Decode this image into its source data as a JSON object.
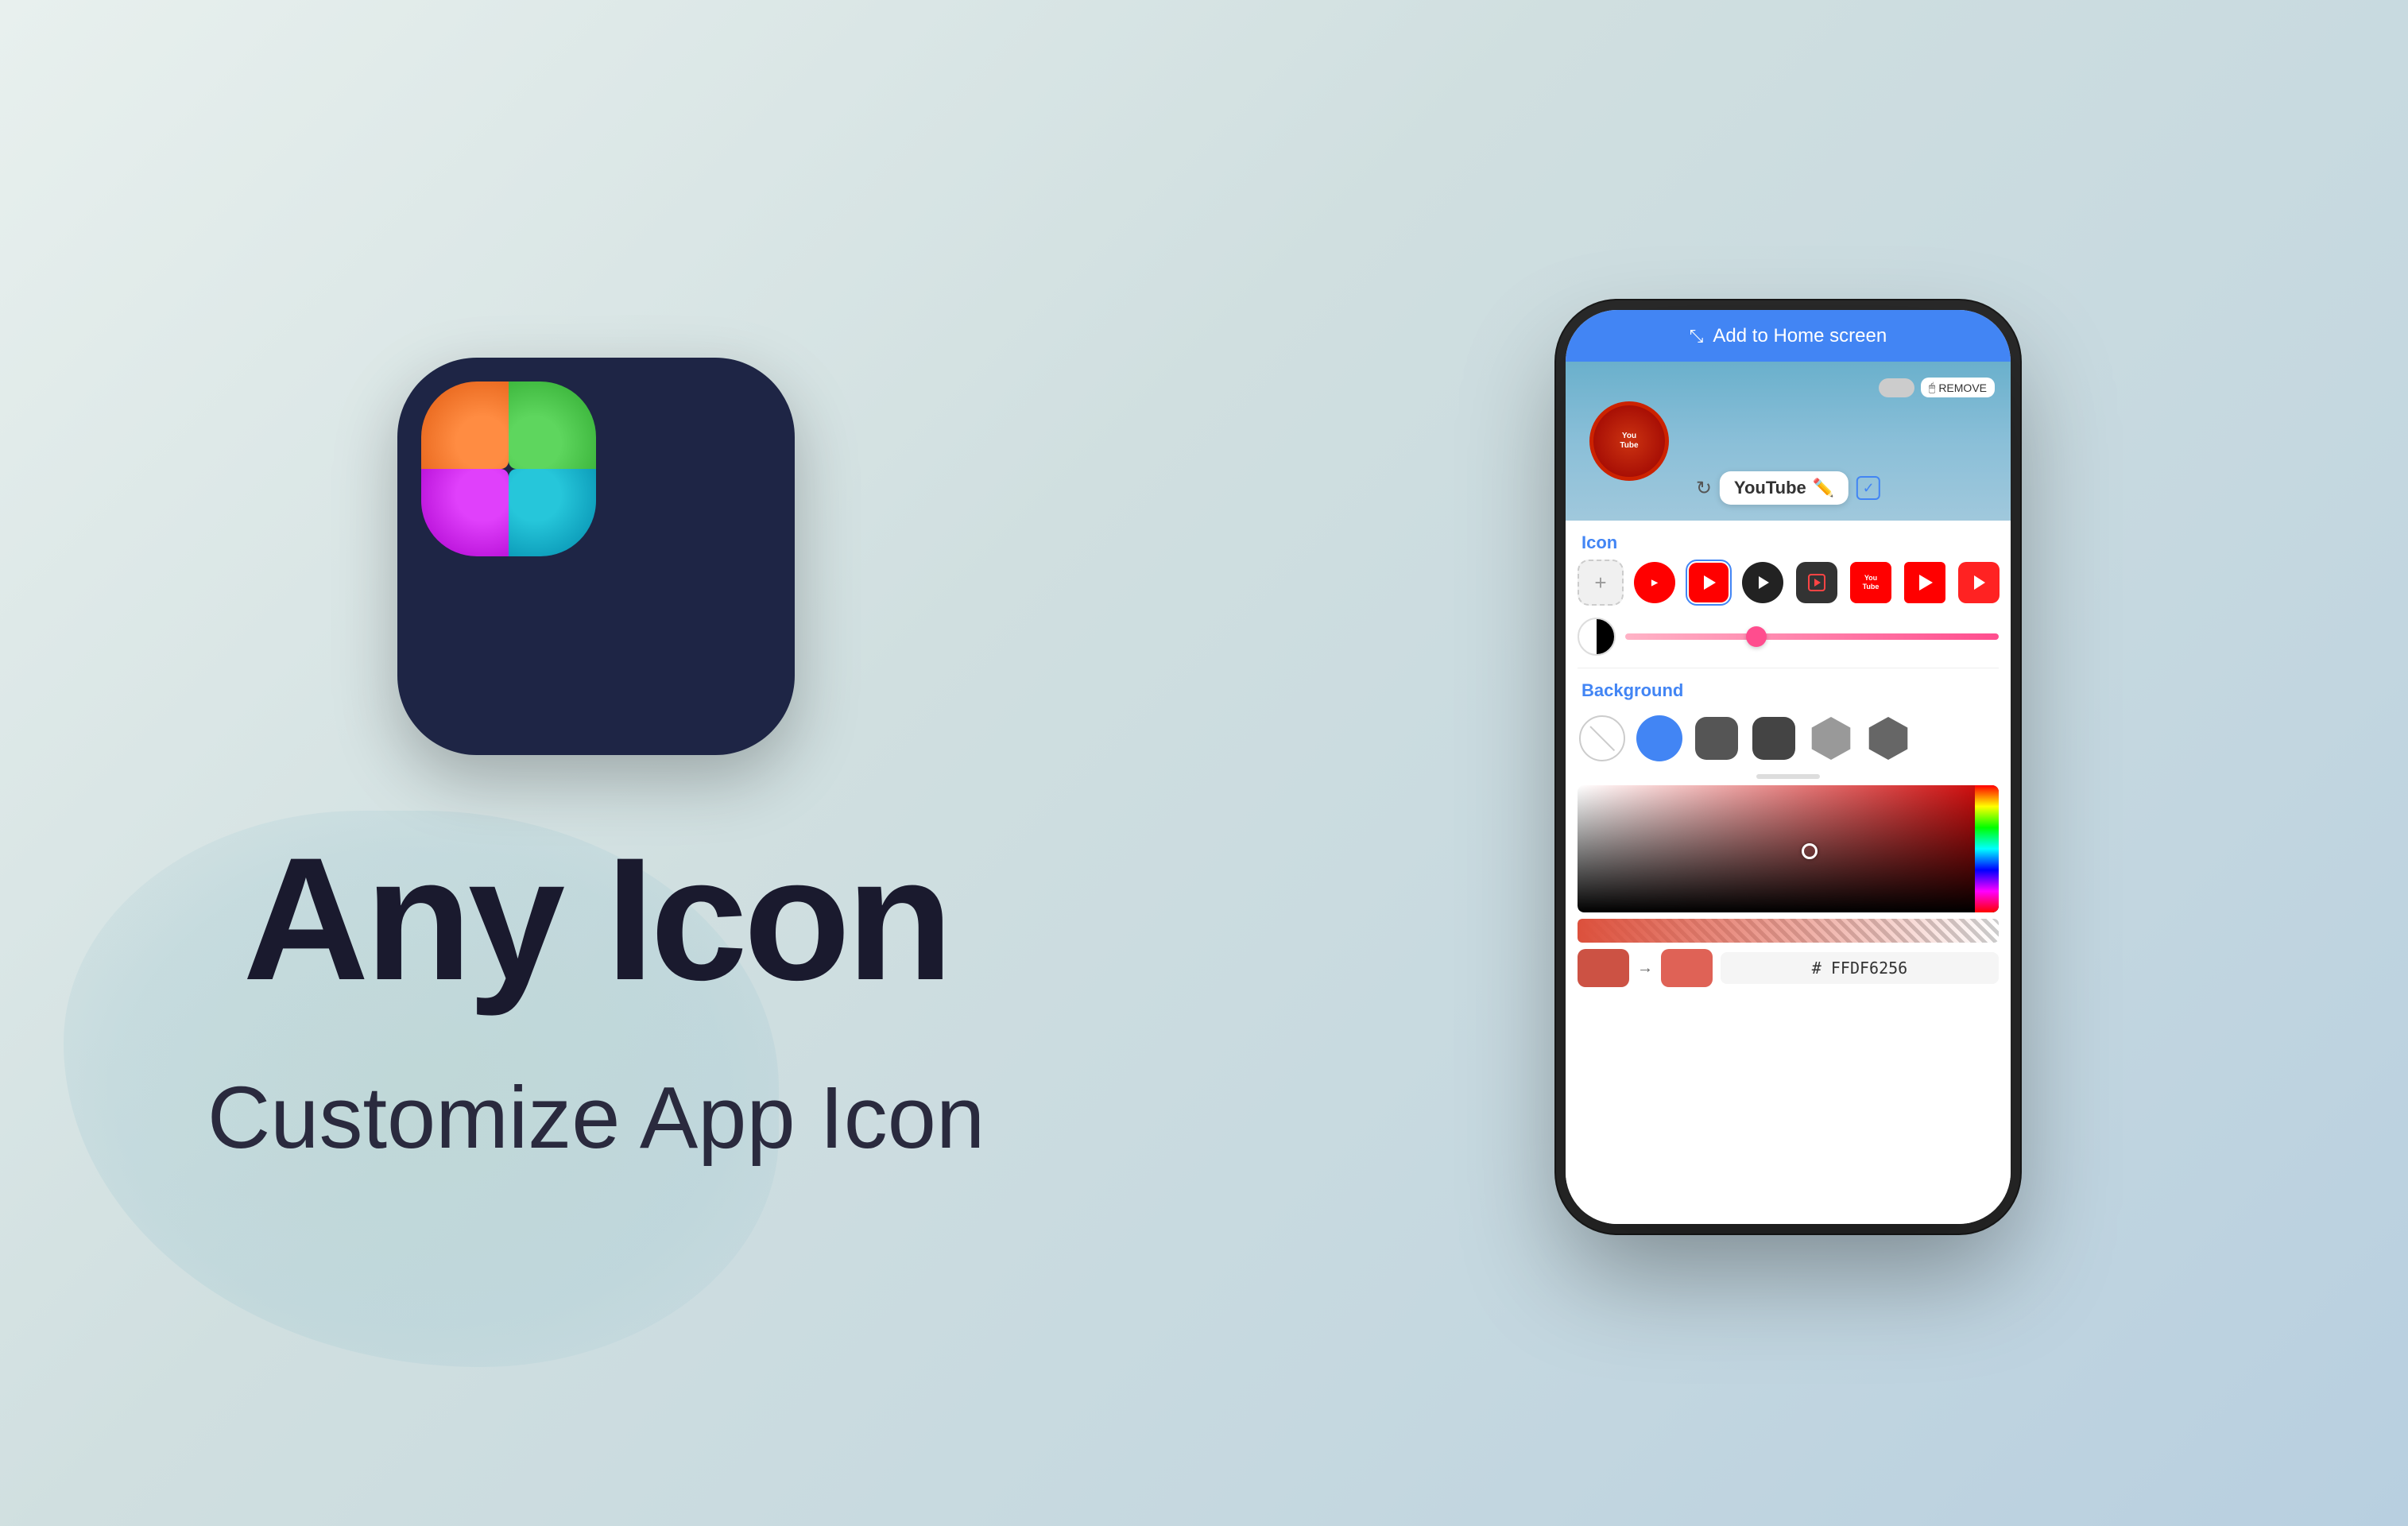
{
  "background": {
    "color_start": "#e8f0ee",
    "color_end": "#b8cfe0"
  },
  "left": {
    "main_title": "Any Icon",
    "sub_title": "Customize App Icon",
    "app_icon": {
      "quadrant_colors": [
        "#ff8c42",
        "#5ed65e",
        "#e040fb",
        "#26c6da"
      ]
    }
  },
  "phone": {
    "header": {
      "title": "Add to Home screen",
      "icon": "⬡"
    },
    "preview": {
      "app_name": "YouTube",
      "toggle_label": "REMOVE"
    },
    "name_field": {
      "value": "YouTube",
      "edit_icon": "✏️"
    },
    "icon_section": {
      "label": "Icon",
      "add_button": "+",
      "icons": [
        {
          "type": "yt-red-circle",
          "selected": false
        },
        {
          "type": "yt-red-square",
          "selected": true
        },
        {
          "type": "yt-dark-circle",
          "selected": false
        },
        {
          "type": "yt-dark-circle-outline",
          "selected": false
        },
        {
          "type": "yt-red-plain",
          "selected": false
        },
        {
          "type": "yt-red-simple",
          "selected": false
        },
        {
          "type": "yt-red-rounded",
          "selected": false
        }
      ]
    },
    "slider": {
      "value": 35
    },
    "background_section": {
      "label": "Background",
      "shapes": [
        "none",
        "circle",
        "squircle-dark",
        "squircle-darker",
        "hexagon-light",
        "hexagon-dark"
      ]
    },
    "color_picker": {
      "hex_value": "#FFDF6256",
      "display_value": "# FFDF6256",
      "swatch_current": "#cc5244",
      "swatch_new": "#df6256"
    }
  }
}
